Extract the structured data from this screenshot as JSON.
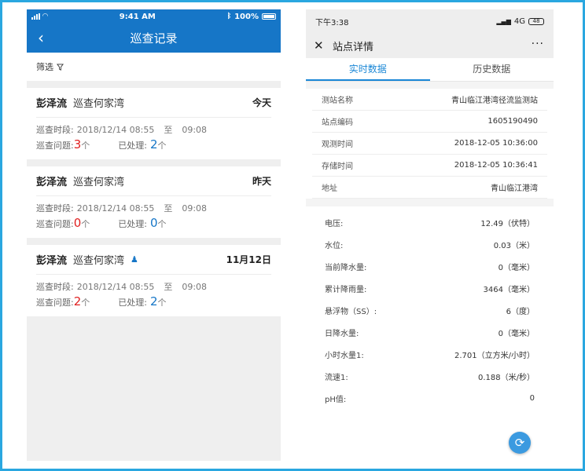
{
  "left": {
    "status": {
      "time": "9:41 AM",
      "battery": "100%"
    },
    "nav_title": "巡查记录",
    "filter_label": "筛选",
    "records": [
      {
        "name": "彭泽流",
        "place": "巡查何家湾",
        "date": "今天",
        "has_user_icon": false,
        "period_label": "巡查时段:",
        "start": "2018/12/14  08:55",
        "to": "至",
        "end": "09:08",
        "issues_label": "巡查问题:",
        "issues": "3",
        "unit": "个",
        "handled_label": "已处理:",
        "handled": "2"
      },
      {
        "name": "彭泽流",
        "place": "巡查何家湾",
        "date": "昨天",
        "has_user_icon": false,
        "period_label": "巡查时段:",
        "start": "2018/12/14  08:55",
        "to": "至",
        "end": "09:08",
        "issues_label": "巡查问题:",
        "issues": "0",
        "unit": "个",
        "handled_label": "已处理:",
        "handled": "0"
      },
      {
        "name": "彭泽流",
        "place": "巡查何家湾",
        "date": "11月12日",
        "has_user_icon": true,
        "period_label": "巡查时段:",
        "start": "2018/12/14  08:55",
        "to": "至",
        "end": "09:08",
        "issues_label": "巡查问题:",
        "issues": "2",
        "unit": "个",
        "handled_label": "已处理:",
        "handled": "2"
      }
    ],
    "colors": {
      "primary": "#1676c7",
      "issue": "#e02020"
    }
  },
  "right": {
    "status": {
      "time": "下午3:38",
      "network": "4G",
      "battery": "48"
    },
    "nav_title": "站点详情",
    "more": "···",
    "tabs": [
      {
        "label": "实时数据",
        "active": true
      },
      {
        "label": "历史数据",
        "active": false
      }
    ],
    "info": [
      {
        "k": "测站名称",
        "v": "青山临江港湾径流监测站"
      },
      {
        "k": "站点编码",
        "v": "1605190490"
      },
      {
        "k": "观测时间",
        "v": "2018-12-05 10:36:00"
      },
      {
        "k": "存储时间",
        "v": "2018-12-05 10:36:41"
      },
      {
        "k": "地址",
        "v": "青山临江港湾"
      }
    ],
    "data": [
      {
        "k": "电压:",
        "v": "12.49（伏特）"
      },
      {
        "k": "水位:",
        "v": "0.03（米）"
      },
      {
        "k": "当前降水量:",
        "v": "0（毫米）"
      },
      {
        "k": "累计降雨量:",
        "v": "3464（毫米）"
      },
      {
        "k": "悬浮物（SS）:",
        "v": "6（度）"
      },
      {
        "k": "日降水量:",
        "v": "0（毫米）"
      },
      {
        "k": "小时水量1:",
        "v": "2.701（立方米/小时）"
      },
      {
        "k": "流速1:",
        "v": "0.188（米/秒）"
      },
      {
        "k": "pH值:",
        "v": "0"
      }
    ],
    "colors": {
      "accent": "#1a87d6",
      "refresh": "#3b9ae0"
    }
  }
}
